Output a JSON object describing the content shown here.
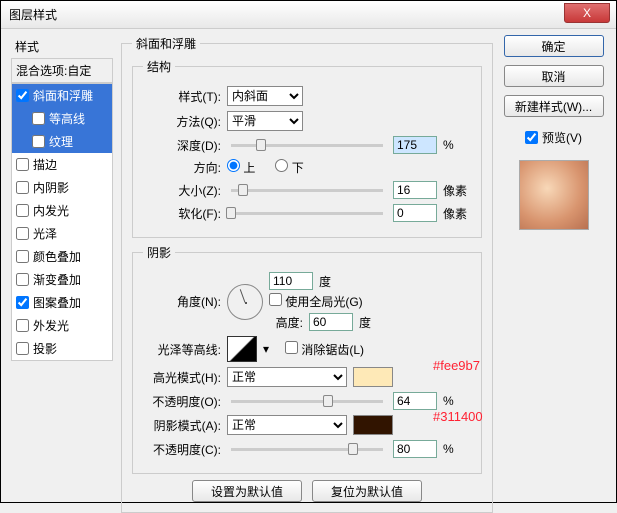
{
  "window": {
    "title": "图层样式"
  },
  "close_x": "X",
  "left": {
    "header": "样式",
    "blend": "混合选项:自定",
    "items": [
      {
        "label": "斜面和浮雕",
        "checked": true,
        "sel": true,
        "indent": false
      },
      {
        "label": "等高线",
        "checked": false,
        "sel": true,
        "indent": true
      },
      {
        "label": "纹理",
        "checked": false,
        "sel": true,
        "indent": true
      },
      {
        "label": "描边",
        "checked": false,
        "sel": false,
        "indent": false
      },
      {
        "label": "内阴影",
        "checked": false,
        "sel": false,
        "indent": false
      },
      {
        "label": "内发光",
        "checked": false,
        "sel": false,
        "indent": false
      },
      {
        "label": "光泽",
        "checked": false,
        "sel": false,
        "indent": false
      },
      {
        "label": "颜色叠加",
        "checked": false,
        "sel": false,
        "indent": false
      },
      {
        "label": "渐变叠加",
        "checked": false,
        "sel": false,
        "indent": false
      },
      {
        "label": "图案叠加",
        "checked": true,
        "sel": false,
        "indent": false
      },
      {
        "label": "外发光",
        "checked": false,
        "sel": false,
        "indent": false
      },
      {
        "label": "投影",
        "checked": false,
        "sel": false,
        "indent": false
      }
    ]
  },
  "bevel": {
    "group_title": "斜面和浮雕",
    "structure_title": "结构",
    "style_label": "样式(T):",
    "style_value": "内斜面",
    "technique_label": "方法(Q):",
    "technique_value": "平滑",
    "depth_label": "深度(D):",
    "depth_value": "175",
    "depth_unit": "%",
    "direction_label": "方向:",
    "dir_up": "上",
    "dir_down": "下",
    "size_label": "大小(Z):",
    "size_value": "16",
    "size_unit": "像素",
    "soften_label": "软化(F):",
    "soften_value": "0",
    "soften_unit": "像素"
  },
  "shading": {
    "title": "阴影",
    "angle_label": "角度(N):",
    "angle_value": "110",
    "angle_unit": "度",
    "global_label": "使用全局光(G)",
    "altitude_label": "高度:",
    "altitude_value": "60",
    "altitude_unit": "度",
    "gloss_label": "光泽等高线:",
    "antialias_label": "消除锯齿(L)",
    "hl_mode_label": "高光模式(H):",
    "hl_mode_value": "正常",
    "hl_color": "#fee9b7",
    "hl_opacity_label": "不透明度(O):",
    "hl_opacity_value": "64",
    "sh_mode_label": "阴影模式(A):",
    "sh_mode_value": "正常",
    "sh_color": "#311400",
    "sh_opacity_label": "不透明度(C):",
    "sh_opacity_value": "80",
    "pct": "%"
  },
  "bottom": {
    "make_default": "设置为默认值",
    "reset_default": "复位为默认值"
  },
  "right": {
    "ok": "确定",
    "cancel": "取消",
    "new_style": "新建样式(W)...",
    "preview_label": "预览(V)"
  },
  "annotations": {
    "hl": "#fee9b7",
    "sh": "#311400"
  }
}
